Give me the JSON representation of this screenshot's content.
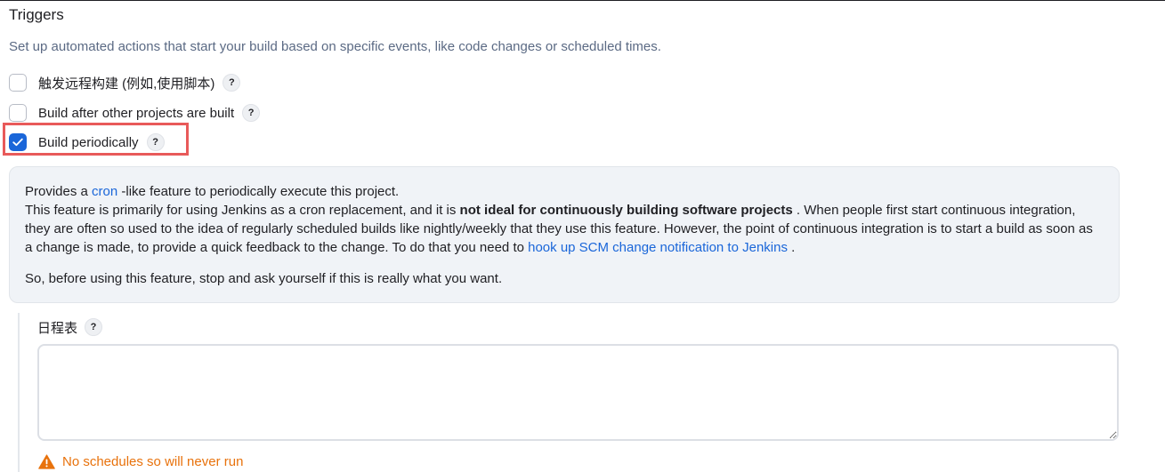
{
  "section": {
    "title": "Triggers",
    "description": "Set up automated actions that start your build based on specific events, like code changes or scheduled times."
  },
  "triggers": [
    {
      "label": "触发远程构建 (例如,使用脚本)",
      "checked": false,
      "help": "?"
    },
    {
      "label": "Build after other projects are built",
      "checked": false,
      "help": "?"
    },
    {
      "label": "Build periodically",
      "checked": true,
      "help": "?"
    }
  ],
  "help_panel": {
    "p1_before_link": "Provides a ",
    "p1_link": "cron",
    "p1_after_link": " -like feature to periodically execute this project.",
    "p2_before_bold": "This feature is primarily for using Jenkins as a cron replacement, and it is ",
    "p2_bold": "not ideal for continuously building software projects",
    "p2_after_bold": " . When people first start continuous integration, they are often so used to the idea of regularly scheduled builds like nightly/weekly that they use this feature. However, the point of continuous integration is to start a build as soon as a change is made, to provide a quick feedback to the change. To do that you need to ",
    "p2_link": "hook up SCM change notification to Jenkins",
    "p2_end": " .",
    "p3": "So, before using this feature, stop and ask yourself if this is really what you want."
  },
  "schedule": {
    "label": "日程表",
    "help": "?",
    "value": ""
  },
  "warning": {
    "text": "No schedules so will never run"
  },
  "colors": {
    "accent": "#1a66d9",
    "highlight": "#e85a5a",
    "warning": "#e8720c",
    "description": "#5b6a84"
  }
}
